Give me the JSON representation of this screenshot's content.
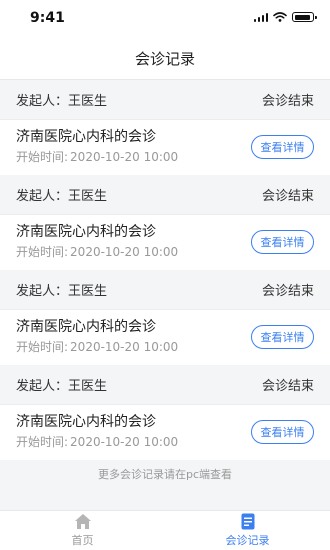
{
  "status_bar": {
    "time": "9:41"
  },
  "header": {
    "title": "会诊记录"
  },
  "records": [
    {
      "initiator": "发起人：王医生",
      "status": "会诊结束",
      "title": "济南医院心内科的会诊",
      "time_label": "开始时间:",
      "time_value": "2020-10-20 10:00",
      "button": "查看详情"
    },
    {
      "initiator": "发起人：王医生",
      "status": "会诊结束",
      "title": "济南医院心内科的会诊",
      "time_label": "开始时间:",
      "time_value": "2020-10-20 10:00",
      "button": "查看详情"
    },
    {
      "initiator": "发起人：王医生",
      "status": "会诊结束",
      "title": "济南医院心内科的会诊",
      "time_label": "开始时间:",
      "time_value": "2020-10-20 10:00",
      "button": "查看详情"
    },
    {
      "initiator": "发起人：王医生",
      "status": "会诊结束",
      "title": "济南医院心内科的会诊",
      "time_label": "开始时间:",
      "time_value": "2020-10-20 10:00",
      "button": "查看详情"
    }
  ],
  "footer_note": "更多会诊记录请在pc端查看",
  "tabbar": {
    "items": [
      {
        "label": "首页",
        "icon": "home-icon",
        "active": false
      },
      {
        "label": "会诊记录",
        "icon": "document-icon",
        "active": true
      }
    ]
  },
  "colors": {
    "accent": "#3b7ff0",
    "inactive": "#999999",
    "background": "#f4f5f7"
  }
}
